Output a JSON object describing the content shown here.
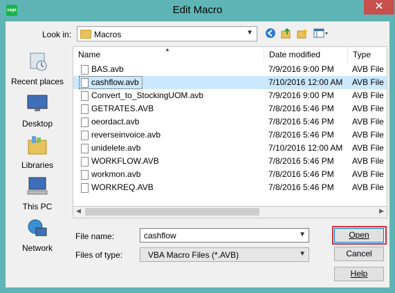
{
  "window": {
    "title": "Edit Macro",
    "app_icon_text": "sage"
  },
  "toolbar": {
    "look_in_label": "Look in:",
    "look_in_value": "Macros"
  },
  "sidebar": {
    "places": [
      {
        "label": "Recent places"
      },
      {
        "label": "Desktop"
      },
      {
        "label": "Libraries"
      },
      {
        "label": "This PC"
      },
      {
        "label": "Network"
      }
    ]
  },
  "columns": {
    "name": "Name",
    "date": "Date modified",
    "type": "Type"
  },
  "files": [
    {
      "name": "BAS.avb",
      "date": "7/9/2016 9:00 PM",
      "type": "AVB File"
    },
    {
      "name": "cashflow.avb",
      "date": "7/10/2016 12:00 AM",
      "type": "AVB File",
      "selected": true
    },
    {
      "name": "Convert_to_StockingUOM.avb",
      "date": "7/9/2016 9:00 PM",
      "type": "AVB File"
    },
    {
      "name": "GETRATES.AVB",
      "date": "7/8/2016 5:46 PM",
      "type": "AVB File"
    },
    {
      "name": "oeordact.avb",
      "date": "7/8/2016 5:46 PM",
      "type": "AVB File"
    },
    {
      "name": "reverseinvoice.avb",
      "date": "7/8/2016 5:46 PM",
      "type": "AVB File"
    },
    {
      "name": "unidelete.avb",
      "date": "7/10/2016 12:00 AM",
      "type": "AVB File"
    },
    {
      "name": "WORKFLOW.AVB",
      "date": "7/8/2016 5:46 PM",
      "type": "AVB File"
    },
    {
      "name": "workmon.avb",
      "date": "7/8/2016 5:46 PM",
      "type": "AVB File"
    },
    {
      "name": "WORKREQ.AVB",
      "date": "7/8/2016 5:46 PM",
      "type": "AVB File"
    }
  ],
  "form": {
    "file_name_label": "File name:",
    "file_name_value": "cashflow",
    "file_type_label": "Files of type:",
    "file_type_value": "VBA Macro Files (*.AVB)"
  },
  "buttons": {
    "open": "Open",
    "cancel": "Cancel",
    "help": "Help"
  },
  "colors": {
    "title_bar": "#5fb5b5",
    "selection": "#cce8ff",
    "close": "#c7504c",
    "highlight": "#d0303a"
  }
}
